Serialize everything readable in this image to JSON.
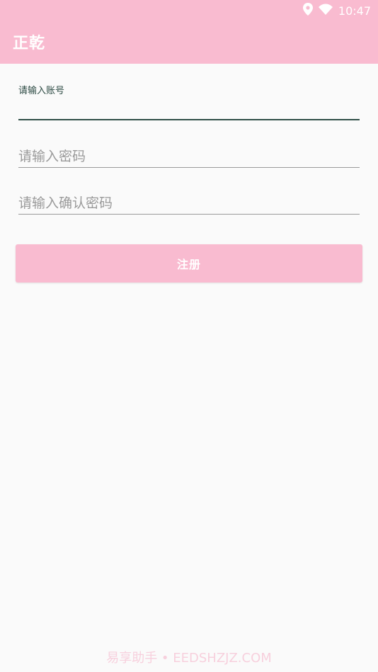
{
  "statusbar": {
    "time": "10:47",
    "icons": [
      "location-icon",
      "wifi-icon"
    ]
  },
  "appbar": {
    "title": "正乾",
    "color": "#f9bbd0"
  },
  "form": {
    "account_label": "请输入账号",
    "account_value": "",
    "password_placeholder": "请输入密码",
    "password_value": "",
    "confirm_placeholder": "请输入确认密码",
    "confirm_value": ""
  },
  "actions": {
    "register_label": "注册"
  },
  "watermark": "易享助手 • EEDSHZJZ.COM"
}
